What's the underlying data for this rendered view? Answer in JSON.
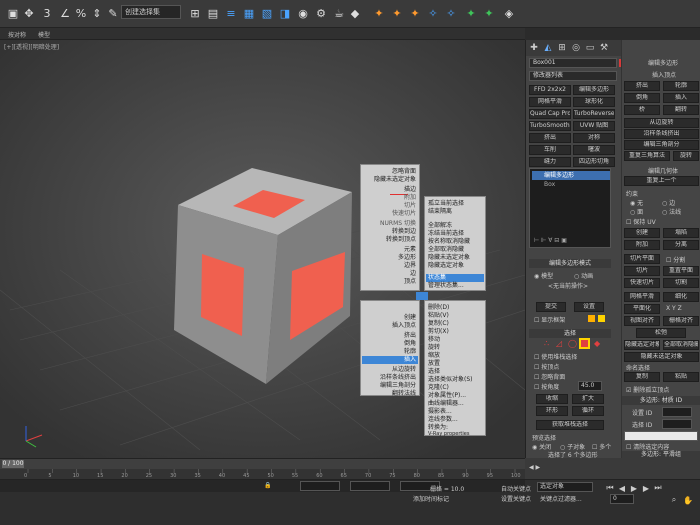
{
  "colors": {
    "accent": "#3d86d6",
    "cube_face": "#9a9a9a",
    "red_poly": "#f0604f",
    "select_box": "#ffd400"
  },
  "toolbar": {
    "icons": [
      "select-icon",
      "move-icon",
      "rotate-icon",
      "scale-icon",
      "snap-icon",
      "angle-snap-icon",
      "percent-snap-icon",
      "spinner-snap-icon",
      "named-sets-icon",
      "mirror-icon",
      "align-icon",
      "layer-icon",
      "graph-icon",
      "material-icon",
      "render-setup-icon",
      "render-frame-icon",
      "render-icon",
      "teapot-icon"
    ],
    "named_selection": "创建选择集",
    "view_mode": "视图"
  },
  "menubar": {
    "items": [
      "按对称",
      "模型"
    ]
  },
  "viewport": {
    "label": "[+][透视][明暗处理]"
  },
  "quad_menu": {
    "top_left": [
      "忽略背面",
      "隐藏未选定对象",
      "描边",
      "附加",
      "切片",
      "快速切片",
      "NURMS 切换",
      "转换到边",
      "转换到顶点",
      "元素",
      "多边形",
      "边界",
      "边",
      "顶点",
      "顶层级"
    ],
    "top_right": [
      "孤立当前选择",
      "结束隔离",
      "全部解冻",
      "冻结当前选择",
      "按名称取消隐藏",
      "全部取消隐藏",
      "隐藏未选定对象",
      "隐藏选定对象",
      "状态集",
      "管理状态集..."
    ],
    "bottom_left": [
      "创建",
      "插入顶点",
      "挤出",
      "倒角",
      "轮廓",
      "插入",
      "从边旋转",
      "沿样条线挤出",
      "编辑三角剖分",
      "翻转法线"
    ],
    "bottom_right": [
      "移动",
      "旋转",
      "缩放",
      "放置",
      "选择",
      "选择类似对象(S)",
      "克隆(C)",
      "对象属性(P)...",
      "曲线编辑器...",
      "摄影表...",
      "连线参数...",
      "转换为:",
      "V-Ray properties",
      "剪切(X)",
      "复制(C)",
      "粘贴(V)",
      "删除(D)"
    ]
  },
  "command_panel": {
    "object_name": "Box001",
    "modifier_list": "修改器列表",
    "buttons": [
      "FFD 2x2x2",
      "编辑多边形",
      "网格平滑",
      "球形化",
      "Quad Cap Pro",
      "TurboReverse",
      "TurboSmooth Pro",
      "UVW 贴图",
      "挤出",
      "对称",
      "车削",
      "噻波",
      "缝力",
      "四边形切角"
    ],
    "stack": [
      "编辑多边形",
      "Box"
    ],
    "rollout_mode": "编辑多边形模式",
    "model": "模型",
    "animation": "动画",
    "no_operation": "<无当前操作>",
    "commit": "提交",
    "settings": "设置",
    "cancel": "取消",
    "show_cage": "显示框架",
    "rollout_select": "选择",
    "use_stack": "使用堆栈选择",
    "by_vertex": "按顶点",
    "ignore_back": "忽略背面",
    "by_angle": "按角度",
    "angle_val": "45.0",
    "shrink": "收缩",
    "grow": "扩大",
    "ring": "环形",
    "loop": "循环",
    "get_stack": "获取堆栈选择",
    "preview": "预览选择",
    "off": "关闭",
    "subobj": "子对象",
    "multi": "多个",
    "selected_count": "选择了 6 个多边形",
    "soft_sel": "软选择"
  },
  "right_panel": {
    "rollout_vertex": "编辑多边形",
    "insert_vertex": "插入顶点",
    "extrude": "挤出",
    "outline": "轮廓",
    "bevel": "倒角",
    "insert": "插入",
    "bridge": "桥",
    "flip": "翻转",
    "hinge": "从边旋转",
    "along_spline": "沿样条线挤出",
    "edit_tri": "编辑三角剖分",
    "retri": "重复三角算法",
    "turn": "旋转",
    "rollout_geom": "编辑几何体",
    "repeat_last": "重复上一个",
    "constraint": "约束",
    "none": "无",
    "edge": "边",
    "face": "面",
    "normal": "法线",
    "preserve_uv": "保持 UV",
    "create": "创建",
    "collapse": "塌陷",
    "attach": "附加",
    "detach": "分离",
    "slice_plane": "切片平面",
    "split": "分割",
    "slice": "切片",
    "reset_plane": "重置平面",
    "quickslice": "快速切片",
    "cut": "切割",
    "meshsmooth": "网格平滑",
    "tessellate": "细化",
    "planarize": "平面化",
    "view_align": "视图对齐",
    "grid_align": "栅格对齐",
    "relax": "松弛",
    "hide_sel": "隐藏选定对象",
    "unhide_all": "全部取消隐藏",
    "hide_unsel": "隐藏未选定对象",
    "named_sel": "命名选择",
    "copy": "复制",
    "paste": "粘贴",
    "delete_iso": "删除孤立顶点",
    "rollout_mat": "多边形: 材质 ID",
    "set_id": "设置 ID",
    "select_id": "选择 ID",
    "clear_sel": "清除选定内容",
    "rollout_smooth": "多边形: 平滑组"
  },
  "timeline": {
    "frames": [
      "0",
      "5",
      "10",
      "15",
      "20",
      "25",
      "30",
      "35",
      "40",
      "45",
      "50",
      "55",
      "60",
      "65",
      "70",
      "75",
      "80",
      "85",
      "90",
      "95",
      "100"
    ],
    "counter": "0 / 100"
  },
  "status": {
    "grid": "栅格 = 10.0",
    "add_time_tag": "添加时间标记",
    "auto_key": "自动关键点",
    "selected": "选定对象",
    "set_key": "设置关键点",
    "key_filters": "关键点过滤器...",
    "frame": "0"
  }
}
